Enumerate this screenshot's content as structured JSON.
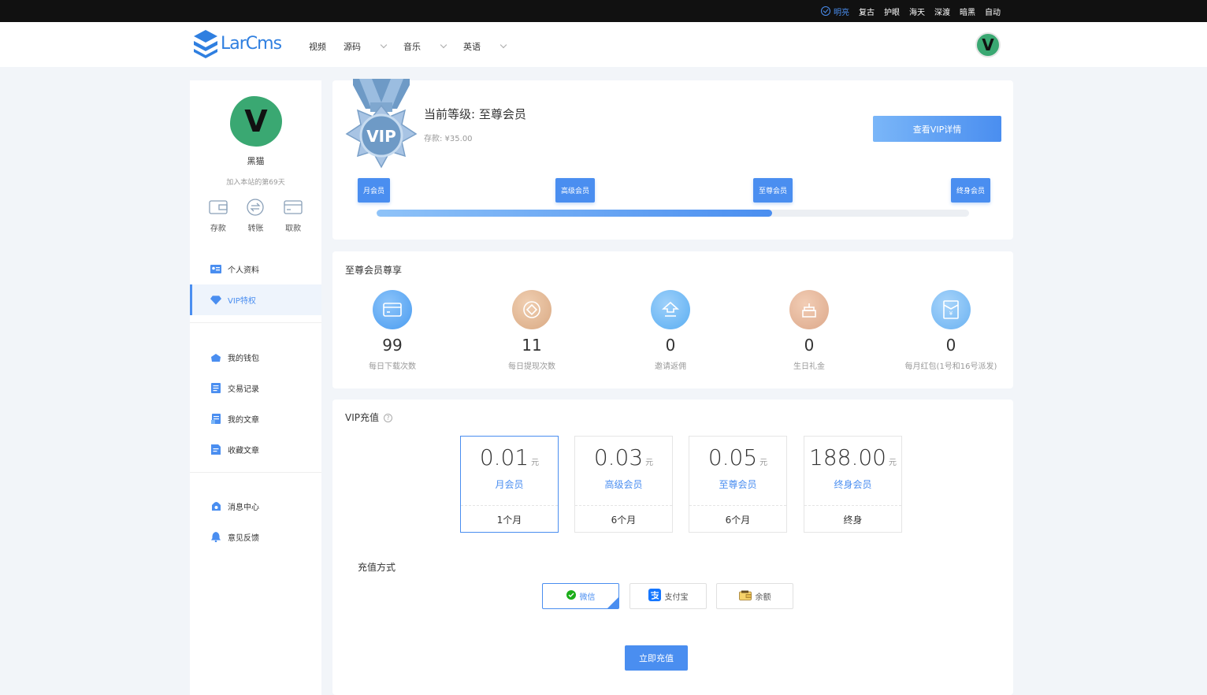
{
  "themes": {
    "active": "明亮",
    "items": [
      "复古",
      "护眼",
      "海天",
      "深渡",
      "暗黑",
      "自动"
    ]
  },
  "header": {
    "logo_text": "LarCms",
    "nav": [
      "视频",
      "源码",
      "音乐",
      "英语"
    ],
    "avatar_letter": "V"
  },
  "sidebar": {
    "avatar_letter": "V",
    "username": "黑猫",
    "joined": "加入本站的第69天",
    "quick": [
      "存款",
      "转账",
      "取款"
    ],
    "menu_group1": [
      "个人资料",
      "VIP特权"
    ],
    "menu_group2": [
      "我的钱包",
      "交易记录",
      "我的文章",
      "收藏文章"
    ],
    "menu_group3": [
      "消息中心",
      "意见反馈"
    ],
    "active_item": "VIP特权"
  },
  "level": {
    "medal_text": "VIP",
    "title": "当前等级: 至尊会员",
    "deposit": "存款: ¥35.00",
    "details_button": "查看VIP详情",
    "tiers": [
      "月会员",
      "高级会员",
      "至尊会员",
      "终身会员"
    ],
    "progress_percent": 66.7
  },
  "perks": {
    "title": "至尊会员尊享",
    "items": [
      {
        "value": "99",
        "label": "每日下载次数",
        "icon": "download-card-icon",
        "color": "#4a9cf0"
      },
      {
        "value": "11",
        "label": "每日提现次数",
        "icon": "coin-icon",
        "color": "#d9a983"
      },
      {
        "value": "0",
        "label": "邀请返佣",
        "icon": "upload-gift-icon",
        "color": "#5aaef2"
      },
      {
        "value": "0",
        "label": "生日礼金",
        "icon": "cake-icon",
        "color": "#dca88a"
      },
      {
        "value": "0",
        "label": "每月红包(1号和16号派发)",
        "icon": "red-packet-icon",
        "color": "#6ab2f2"
      }
    ]
  },
  "recharge": {
    "title": "VIP充值",
    "help_glyph": "?",
    "plans": [
      {
        "price": "0.01",
        "unit": "元",
        "name": "月会员",
        "duration": "1个月"
      },
      {
        "price": "0.03",
        "unit": "元",
        "name": "高级会员",
        "duration": "6个月"
      },
      {
        "price": "0.05",
        "unit": "元",
        "name": "至尊会员",
        "duration": "6个月"
      },
      {
        "price": "188.00",
        "unit": "元",
        "name": "终身会员",
        "duration": "终身"
      }
    ],
    "selected_plan": 0,
    "pay_label": "充值方式",
    "methods": [
      "微信",
      "支付宝",
      "余额"
    ],
    "selected_method": 0,
    "submit": "立即充值"
  },
  "colors": {
    "accent": "#4a8ef0",
    "brand": "#2f7fe0",
    "avatar": "#3aa872"
  }
}
